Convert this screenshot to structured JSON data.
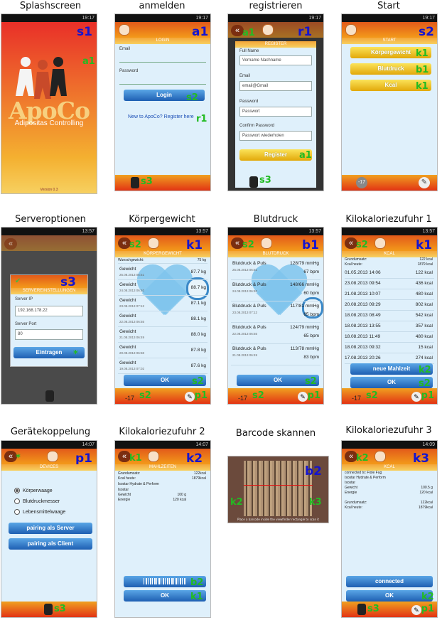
{
  "captions": [
    "Splashscreen",
    "anmelden",
    "registrieren",
    "Start",
    "Serveroptionen",
    "Körpergewicht",
    "Blutdruck",
    "Kilokaloriezufuhr 1",
    "Gerätekoppelung",
    "Kilokaloriezufuhr 2",
    "Barcode skannen",
    "Kilokaloriezufuhr 3"
  ],
  "time": [
    "19:17",
    "13:57",
    "14:07",
    "14:09"
  ],
  "s1": {
    "tag": "s1",
    "tag2": "a1",
    "brand": "ApoCo",
    "subtitle": "Adipositas Controlling",
    "version": "Version 0.3"
  },
  "a1": {
    "tag": "a1",
    "title": "LOGIN",
    "email_label": "Email",
    "password_label": "Password",
    "login_button": "Login",
    "login_tag": "s2",
    "register_link": "New to ApoCo? Register here",
    "link_tag": "r1",
    "footer_tag": "s3"
  },
  "r1": {
    "tag": "r1",
    "back_tag": "a1",
    "title": "REGISTER",
    "name_label": "Full Name",
    "name_value": "Vorname Nachname",
    "email_label": "Email",
    "email_value": "email@Gmail",
    "password_label": "Password",
    "password_value": "Passwort",
    "repeat_label": "Confirm Password",
    "repeat_value": "Passwort wiederholen",
    "button": "Register",
    "button_tag": "a1",
    "footer_tag": "s3"
  },
  "s2": {
    "tag": "s2",
    "title": "START",
    "btn1": "Körpergewicht",
    "btn1_tag": "k1",
    "btn2": "Blutdruck",
    "btn2_tag": "b1",
    "btn3": "Kcal",
    "btn3_tag": "k1",
    "foot_left": "-17",
    "foot_right_icon": "wrench"
  },
  "s3": {
    "tag": "s3",
    "title": "SERVEREINSTELLUNGEN",
    "ip_label": "Server IP",
    "ip_value": "192.168.178.22",
    "port_label": "Server Port",
    "port_value": "80",
    "button": "Eintragen",
    "star": "*"
  },
  "k1w": {
    "tag": "k1",
    "back_tag": "s2",
    "title": "KÖRPERGEWICHT",
    "header_label": "Wunschgewicht:",
    "header_value": "75 kg",
    "rows": [
      {
        "t": "Gewicht",
        "s": "25.08.2013 06:51",
        "v": "87.7 kg"
      },
      {
        "t": "Gewicht",
        "s": "24.08.2013 06:40",
        "v": "88.7 kg"
      },
      {
        "t": "Gewicht",
        "s": "23.08.2013 07:12",
        "v": "87.1 kg"
      },
      {
        "t": "Gewicht",
        "s": "22.08.2013 06:55",
        "v": "88.1 kg"
      },
      {
        "t": "Gewicht",
        "s": "21.08.2013 06:49",
        "v": "88.0 kg"
      },
      {
        "t": "Gewicht",
        "s": "20.08.2013 06:58",
        "v": "87.8 kg"
      },
      {
        "t": "Gewicht",
        "s": "19.08.2013 07:02",
        "v": "87.6 kg"
      }
    ],
    "ok": "OK",
    "ok_tag": "s2",
    "foot_left": "-17",
    "foot_left_tag": "s2",
    "foot_right_tag": "p1"
  },
  "b1": {
    "tag": "b1",
    "back_tag": "s2",
    "title": "BLUTDRUCK",
    "rows": [
      {
        "t": "Blutdruck & Puls",
        "s": "25.08.2013 06:51",
        "v": "128/79 mmHg",
        "p": "67 bpm"
      },
      {
        "t": "Blutdruck & Puls",
        "s": "24.08.2013 06:40",
        "v": "148/66 mmHg",
        "p": "60 bpm"
      },
      {
        "t": "Blutdruck & Puls",
        "s": "23.08.2013 07:12",
        "v": "117/81 mmHg",
        "p": "65 bpm"
      },
      {
        "t": "Blutdruck & Puls",
        "s": "22.08.2013 06:55",
        "v": "124/79 mmHg",
        "p": "65 bpm"
      },
      {
        "t": "Blutdruck & Puls",
        "s": "21.08.2013 06:49",
        "v": "113/78 mmHg",
        "p": "83 bpm"
      }
    ],
    "ok": "OK",
    "ok_tag": "s2",
    "foot_left": "-17",
    "foot_left_tag": "s2",
    "foot_right_tag": "p1"
  },
  "k1": {
    "tag": "k1",
    "back_tag": "s2",
    "title": "KCAL",
    "h1_label": "Grundumsatz:",
    "h1_value": "122 kcal",
    "h2_label": "Kcal heute:",
    "h2_value": "1879 kcal",
    "rows": [
      {
        "d": "01.05.2013 14:06",
        "v": "122 kcal"
      },
      {
        "d": "23.08.2013 09:54",
        "v": "436 kcal"
      },
      {
        "d": "21.08.2013 10:07",
        "v": "480 kcal"
      },
      {
        "d": "20.08.2013 09:29",
        "v": "802 kcal"
      },
      {
        "d": "18.08.2013 08:49",
        "v": "542 kcal"
      },
      {
        "d": "18.08.2013 13:55",
        "v": "357 kcal"
      },
      {
        "d": "18.08.2013 11:49",
        "v": "480 kcal"
      },
      {
        "d": "18.08.2013 09:32",
        "v": "15 kcal"
      },
      {
        "d": "17.08.2013 20:26",
        "v": "274 kcal"
      }
    ],
    "btn_new": "neue Mahlzeit",
    "btn_new_tag": "k2",
    "ok": "OK",
    "ok_tag": "s2",
    "foot_left": "-17",
    "foot_left_tag": "s2",
    "foot_right_tag": "p1"
  },
  "p1": {
    "tag": "p1",
    "back_tag": "*",
    "title": "DEVICES",
    "opt1": "Körperwaage",
    "opt2": "Blutdruckmesser",
    "opt3": "Lebensmittelwaage",
    "btn1": "pairing als Server",
    "btn2": "pairing als Client",
    "footer_tag": "s3"
  },
  "k2": {
    "tag": "k2",
    "back_tag": "k1",
    "title": "MAHLZEITEN",
    "l1": "Grundumsatz:",
    "v1": "122kcal",
    "l2": "Kcal heute:",
    "v2": "1879kcal",
    "item": "Isostar Hydrate & Perform",
    "item_l": "Isostar",
    "f1": "Gewicht",
    "fv1": "100 g",
    "f2": "Energie",
    "fv2": "120 kcal",
    "barcode_tag": "b2",
    "ok": "OK",
    "ok_tag": "k1"
  },
  "b2": {
    "tag": "b2",
    "left_tag": "k2",
    "right_tag": "k3",
    "hint": "Place a barcode inside the viewfinder rectangle to scan it"
  },
  "k3": {
    "tag": "k3",
    "back_tag": "k2",
    "title": "KCAL",
    "l1": "connected to: Fiole Fug",
    "l2": "Isostar Hydrate & Perform",
    "l3": "Isostar",
    "f1": "Gewicht",
    "fv1": "100.5 g",
    "f2": "Energie",
    "fv2": "120 kcal",
    "g1": "Grundumsatz:",
    "gv1": "122kcal",
    "g2": "Kcal heute:",
    "gv2": "1879kcal",
    "btn": "connected",
    "ok": "OK",
    "ok_tag": "k2",
    "foot_left_tag": "s3",
    "foot_right_tag": "p1"
  }
}
